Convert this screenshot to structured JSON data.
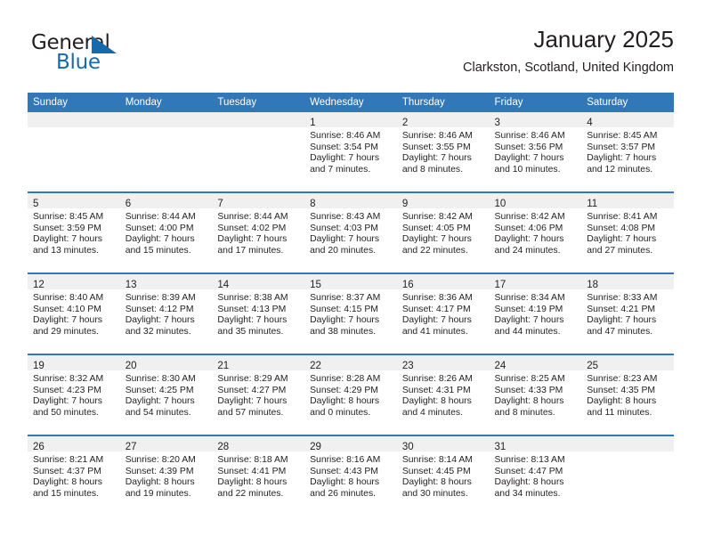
{
  "logo": {
    "word_top": "General",
    "word_bottom": "Blue",
    "triangle_color": "#1569ad"
  },
  "header": {
    "title": "January 2025",
    "subtitle": "Clarkston, Scotland, United Kingdom",
    "accent_color": "#3277b8"
  },
  "weekdays": [
    "Sunday",
    "Monday",
    "Tuesday",
    "Wednesday",
    "Thursday",
    "Friday",
    "Saturday"
  ],
  "weeks": [
    [
      {
        "empty": true
      },
      {
        "empty": true
      },
      {
        "empty": true
      },
      {
        "day": "1",
        "sunrise": "Sunrise: 8:46 AM",
        "sunset": "Sunset: 3:54 PM",
        "daylight1": "Daylight: 7 hours",
        "daylight2": "and 7 minutes."
      },
      {
        "day": "2",
        "sunrise": "Sunrise: 8:46 AM",
        "sunset": "Sunset: 3:55 PM",
        "daylight1": "Daylight: 7 hours",
        "daylight2": "and 8 minutes."
      },
      {
        "day": "3",
        "sunrise": "Sunrise: 8:46 AM",
        "sunset": "Sunset: 3:56 PM",
        "daylight1": "Daylight: 7 hours",
        "daylight2": "and 10 minutes."
      },
      {
        "day": "4",
        "sunrise": "Sunrise: 8:45 AM",
        "sunset": "Sunset: 3:57 PM",
        "daylight1": "Daylight: 7 hours",
        "daylight2": "and 12 minutes."
      }
    ],
    [
      {
        "day": "5",
        "sunrise": "Sunrise: 8:45 AM",
        "sunset": "Sunset: 3:59 PM",
        "daylight1": "Daylight: 7 hours",
        "daylight2": "and 13 minutes."
      },
      {
        "day": "6",
        "sunrise": "Sunrise: 8:44 AM",
        "sunset": "Sunset: 4:00 PM",
        "daylight1": "Daylight: 7 hours",
        "daylight2": "and 15 minutes."
      },
      {
        "day": "7",
        "sunrise": "Sunrise: 8:44 AM",
        "sunset": "Sunset: 4:02 PM",
        "daylight1": "Daylight: 7 hours",
        "daylight2": "and 17 minutes."
      },
      {
        "day": "8",
        "sunrise": "Sunrise: 8:43 AM",
        "sunset": "Sunset: 4:03 PM",
        "daylight1": "Daylight: 7 hours",
        "daylight2": "and 20 minutes."
      },
      {
        "day": "9",
        "sunrise": "Sunrise: 8:42 AM",
        "sunset": "Sunset: 4:05 PM",
        "daylight1": "Daylight: 7 hours",
        "daylight2": "and 22 minutes."
      },
      {
        "day": "10",
        "sunrise": "Sunrise: 8:42 AM",
        "sunset": "Sunset: 4:06 PM",
        "daylight1": "Daylight: 7 hours",
        "daylight2": "and 24 minutes."
      },
      {
        "day": "11",
        "sunrise": "Sunrise: 8:41 AM",
        "sunset": "Sunset: 4:08 PM",
        "daylight1": "Daylight: 7 hours",
        "daylight2": "and 27 minutes."
      }
    ],
    [
      {
        "day": "12",
        "sunrise": "Sunrise: 8:40 AM",
        "sunset": "Sunset: 4:10 PM",
        "daylight1": "Daylight: 7 hours",
        "daylight2": "and 29 minutes."
      },
      {
        "day": "13",
        "sunrise": "Sunrise: 8:39 AM",
        "sunset": "Sunset: 4:12 PM",
        "daylight1": "Daylight: 7 hours",
        "daylight2": "and 32 minutes."
      },
      {
        "day": "14",
        "sunrise": "Sunrise: 8:38 AM",
        "sunset": "Sunset: 4:13 PM",
        "daylight1": "Daylight: 7 hours",
        "daylight2": "and 35 minutes."
      },
      {
        "day": "15",
        "sunrise": "Sunrise: 8:37 AM",
        "sunset": "Sunset: 4:15 PM",
        "daylight1": "Daylight: 7 hours",
        "daylight2": "and 38 minutes."
      },
      {
        "day": "16",
        "sunrise": "Sunrise: 8:36 AM",
        "sunset": "Sunset: 4:17 PM",
        "daylight1": "Daylight: 7 hours",
        "daylight2": "and 41 minutes."
      },
      {
        "day": "17",
        "sunrise": "Sunrise: 8:34 AM",
        "sunset": "Sunset: 4:19 PM",
        "daylight1": "Daylight: 7 hours",
        "daylight2": "and 44 minutes."
      },
      {
        "day": "18",
        "sunrise": "Sunrise: 8:33 AM",
        "sunset": "Sunset: 4:21 PM",
        "daylight1": "Daylight: 7 hours",
        "daylight2": "and 47 minutes."
      }
    ],
    [
      {
        "day": "19",
        "sunrise": "Sunrise: 8:32 AM",
        "sunset": "Sunset: 4:23 PM",
        "daylight1": "Daylight: 7 hours",
        "daylight2": "and 50 minutes."
      },
      {
        "day": "20",
        "sunrise": "Sunrise: 8:30 AM",
        "sunset": "Sunset: 4:25 PM",
        "daylight1": "Daylight: 7 hours",
        "daylight2": "and 54 minutes."
      },
      {
        "day": "21",
        "sunrise": "Sunrise: 8:29 AM",
        "sunset": "Sunset: 4:27 PM",
        "daylight1": "Daylight: 7 hours",
        "daylight2": "and 57 minutes."
      },
      {
        "day": "22",
        "sunrise": "Sunrise: 8:28 AM",
        "sunset": "Sunset: 4:29 PM",
        "daylight1": "Daylight: 8 hours",
        "daylight2": "and 0 minutes."
      },
      {
        "day": "23",
        "sunrise": "Sunrise: 8:26 AM",
        "sunset": "Sunset: 4:31 PM",
        "daylight1": "Daylight: 8 hours",
        "daylight2": "and 4 minutes."
      },
      {
        "day": "24",
        "sunrise": "Sunrise: 8:25 AM",
        "sunset": "Sunset: 4:33 PM",
        "daylight1": "Daylight: 8 hours",
        "daylight2": "and 8 minutes."
      },
      {
        "day": "25",
        "sunrise": "Sunrise: 8:23 AM",
        "sunset": "Sunset: 4:35 PM",
        "daylight1": "Daylight: 8 hours",
        "daylight2": "and 11 minutes."
      }
    ],
    [
      {
        "day": "26",
        "sunrise": "Sunrise: 8:21 AM",
        "sunset": "Sunset: 4:37 PM",
        "daylight1": "Daylight: 8 hours",
        "daylight2": "and 15 minutes."
      },
      {
        "day": "27",
        "sunrise": "Sunrise: 8:20 AM",
        "sunset": "Sunset: 4:39 PM",
        "daylight1": "Daylight: 8 hours",
        "daylight2": "and 19 minutes."
      },
      {
        "day": "28",
        "sunrise": "Sunrise: 8:18 AM",
        "sunset": "Sunset: 4:41 PM",
        "daylight1": "Daylight: 8 hours",
        "daylight2": "and 22 minutes."
      },
      {
        "day": "29",
        "sunrise": "Sunrise: 8:16 AM",
        "sunset": "Sunset: 4:43 PM",
        "daylight1": "Daylight: 8 hours",
        "daylight2": "and 26 minutes."
      },
      {
        "day": "30",
        "sunrise": "Sunrise: 8:14 AM",
        "sunset": "Sunset: 4:45 PM",
        "daylight1": "Daylight: 8 hours",
        "daylight2": "and 30 minutes."
      },
      {
        "day": "31",
        "sunrise": "Sunrise: 8:13 AM",
        "sunset": "Sunset: 4:47 PM",
        "daylight1": "Daylight: 8 hours",
        "daylight2": "and 34 minutes."
      },
      {
        "empty": true
      }
    ]
  ]
}
